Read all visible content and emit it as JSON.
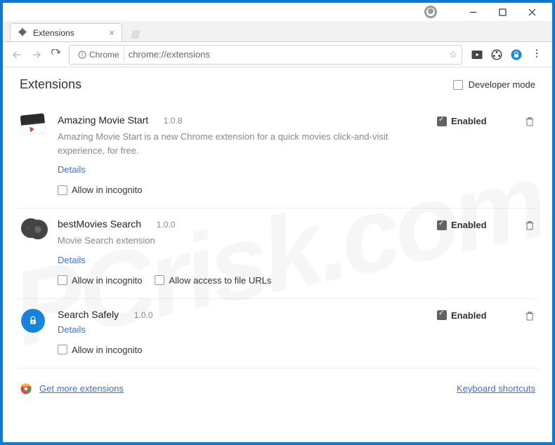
{
  "tab": {
    "title": "Extensions"
  },
  "omnibox": {
    "chip": "Chrome",
    "url": "chrome://extensions"
  },
  "page": {
    "title": "Extensions",
    "devmode_label": "Developer mode",
    "devmode_checked": false
  },
  "extensions": [
    {
      "name": "Amazing Movie Start",
      "version": "1.0.8",
      "description": "Amazing Movie Start is a new Chrome extension for a quick movies click-and-visit experience, for free.",
      "details_label": "Details",
      "enabled": true,
      "enabled_label": "Enabled",
      "incognito_label": "Allow in incognito",
      "incognito_checked": false,
      "file_urls_label": null,
      "file_urls_checked": null
    },
    {
      "name": "bestMovies Search",
      "version": "1.0.0",
      "description": "Movie Search extension",
      "details_label": "Details",
      "enabled": true,
      "enabled_label": "Enabled",
      "incognito_label": "Allow in incognito",
      "incognito_checked": false,
      "file_urls_label": "Allow access to file URLs",
      "file_urls_checked": false
    },
    {
      "name": "Search Safely",
      "version": "1.0.0",
      "description": null,
      "details_label": "Details",
      "enabled": true,
      "enabled_label": "Enabled",
      "incognito_label": "Allow in incognito",
      "incognito_checked": false,
      "file_urls_label": null,
      "file_urls_checked": null
    }
  ],
  "footer": {
    "get_more_label": "Get more extensions",
    "keyboard_label": "Keyboard shortcuts"
  },
  "watermark": "PCrisk.com"
}
